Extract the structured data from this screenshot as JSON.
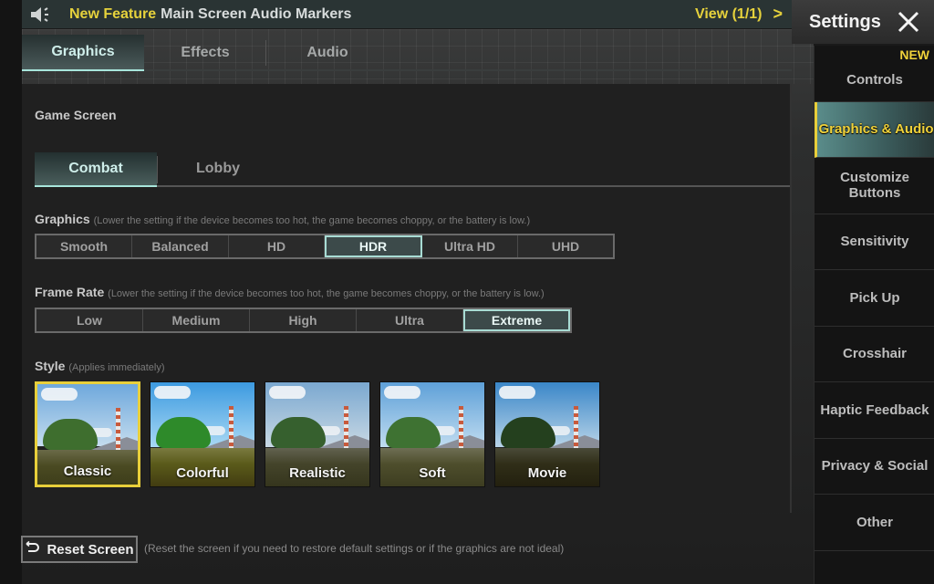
{
  "notice": {
    "icon": "speaker-icon",
    "highlight": "New Feature",
    "message": "Main Screen Audio Markers",
    "view_label": "View (1/1)",
    "chevron": ">"
  },
  "header": {
    "title": "Settings",
    "close_icon": "close-icon"
  },
  "top_tabs": [
    {
      "label": "Graphics",
      "active": true
    },
    {
      "label": "Effects",
      "active": false
    },
    {
      "label": "Audio",
      "active": false
    }
  ],
  "game_screen": {
    "label": "Game Screen",
    "sub_tabs": [
      {
        "label": "Combat",
        "active": true
      },
      {
        "label": "Lobby",
        "active": false
      }
    ]
  },
  "graphics": {
    "label": "Graphics",
    "hint": "(Lower the setting if the device becomes too hot, the game becomes choppy, or the battery is low.)",
    "options": [
      "Smooth",
      "Balanced",
      "HD",
      "HDR",
      "Ultra HD",
      "UHD"
    ],
    "selected": "HDR"
  },
  "frame_rate": {
    "label": "Frame Rate",
    "hint": "(Lower the setting if the device becomes too hot, the game becomes choppy, or the battery is low.)",
    "options": [
      "Low",
      "Medium",
      "High",
      "Ultra",
      "Extreme"
    ],
    "selected": "Extreme"
  },
  "style": {
    "label": "Style",
    "hint": "(Applies immediately)",
    "options": [
      "Classic",
      "Colorful",
      "Realistic",
      "Soft",
      "Movie"
    ],
    "selected": "Classic"
  },
  "footer": {
    "reset_label": "Reset Screen",
    "reset_icon": "undo-icon",
    "reset_hint": "(Reset the screen if you need to restore default settings or if the graphics are not ideal)"
  },
  "sidebar": {
    "items": [
      {
        "label": "Controls",
        "badge": "NEW"
      },
      {
        "label": "Graphics & Audio",
        "active": true
      },
      {
        "label": "Customize Buttons"
      },
      {
        "label": "Sensitivity"
      },
      {
        "label": "Pick Up"
      },
      {
        "label": "Crosshair"
      },
      {
        "label": "Haptic Feedback"
      },
      {
        "label": "Privacy & Social"
      },
      {
        "label": "Other"
      }
    ]
  },
  "colors": {
    "accent_yellow": "#e8cf3a",
    "accent_teal": "#a8e6dc"
  }
}
